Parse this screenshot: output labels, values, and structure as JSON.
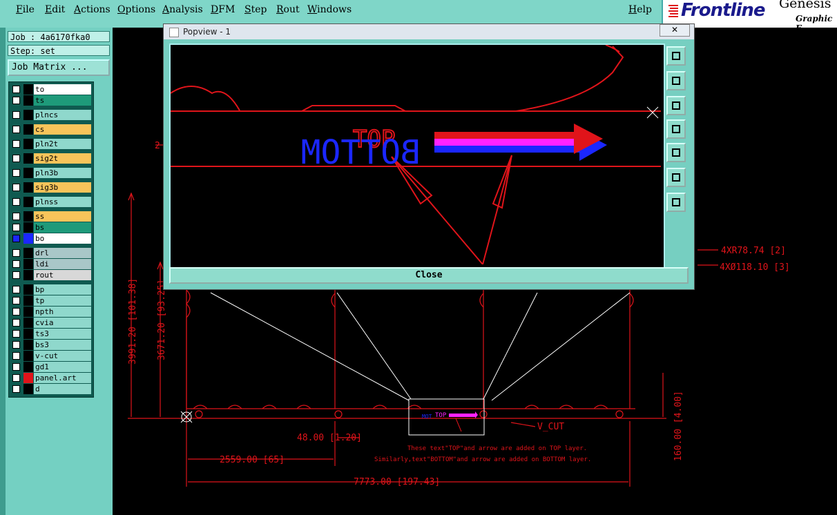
{
  "menu": {
    "items": [
      "File",
      "Edit",
      "Actions",
      "Options",
      "Analysis",
      "DFM",
      "Step",
      "Rout",
      "Windows"
    ],
    "help": "Help"
  },
  "brand": {
    "name": "Frontline",
    "product": "Genesis",
    "sub": "Graphic E"
  },
  "job": {
    "job_label": "Job : 4a6170fka0",
    "step_label": "Step: set",
    "matrix_button": "Job Matrix ..."
  },
  "layers": [
    {
      "name": "to",
      "color": "#ffffff"
    },
    {
      "name": "ts",
      "color": "#1e9a7a"
    },
    {
      "name": "plncs",
      "color": "#8fd8cc"
    },
    {
      "name": "cs",
      "color": "#f7c45a"
    },
    {
      "name": "pln2t",
      "color": "#8fd8cc"
    },
    {
      "name": "sig2t",
      "color": "#f7c45a"
    },
    {
      "name": "pln3b",
      "color": "#8fd8cc"
    },
    {
      "name": "sig3b",
      "color": "#f7c45a"
    },
    {
      "name": "plnss",
      "color": "#8fd8cc"
    },
    {
      "name": "ss",
      "color": "#f7c45a"
    },
    {
      "name": "bs",
      "color": "#1e9a7a"
    },
    {
      "name": "bo",
      "color": "#ffffff"
    },
    {
      "name": "drl",
      "color": "#a9c7c8"
    },
    {
      "name": "ldi",
      "color": "#a9c7c8"
    },
    {
      "name": "rout",
      "color": "#d8d8d8"
    },
    {
      "name": "bp",
      "color": "#8fd8cc"
    },
    {
      "name": "tp",
      "color": "#8fd8cc"
    },
    {
      "name": "npth",
      "color": "#8fd8cc"
    },
    {
      "name": "cvia",
      "color": "#8fd8cc"
    },
    {
      "name": "ts3",
      "color": "#8fd8cc"
    },
    {
      "name": "bs3",
      "color": "#8fd8cc"
    },
    {
      "name": "v-cut",
      "color": "#8fd8cc"
    },
    {
      "name": "gd1",
      "color": "#8fd8cc"
    },
    {
      "name": "panel.art",
      "color": "#8fd8cc"
    },
    {
      "name": "d",
      "color": "#8fd8cc"
    }
  ],
  "popup": {
    "title": "Popview - 1",
    "close_x": "✕",
    "close_button": "Close",
    "text_top": "TOP",
    "text_bottom": "BOTTOM"
  },
  "drawing": {
    "dim_3991": "3991.20 [101.38]",
    "dim_3671": "3671.20 [93.25]",
    "dim_48": "48.00 [1.20]",
    "dim_2559": "2559.00 [65]",
    "dim_7773": "7773.00 [197.43]",
    "dim_160": "160.00 [4.00]",
    "r78": "4XR78.74 [2]",
    "d118": "4XØ118.10 [3]",
    "vcut": "V_CUT",
    "note1": "These text\"TOP\"and arrow are added on TOP layer.",
    "note2": "Similarly,text\"BOTTOM\"and arrow are added on BOTTOM layer.",
    "mini_top": "TOP",
    "mini_bottom": "MOT",
    "partial_2": "2"
  },
  "colors": {
    "red": "#e0141a",
    "magenta": "#ff22ff",
    "blue": "#1b27ff",
    "teal": "#74d0c2"
  }
}
